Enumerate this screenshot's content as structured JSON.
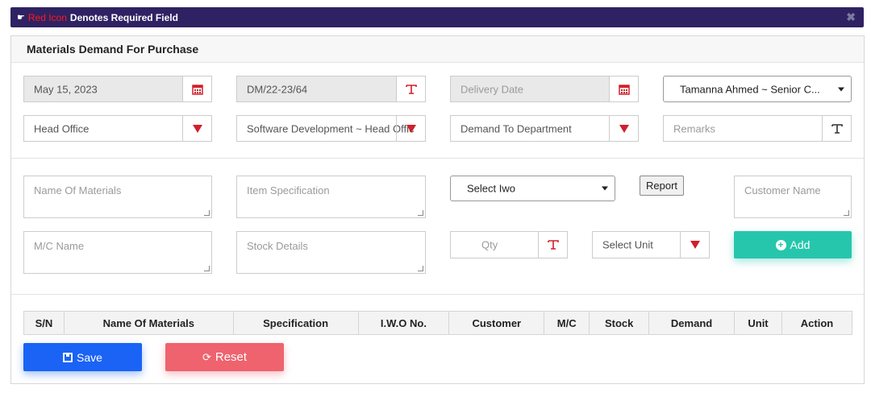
{
  "notice": {
    "hand_icon": "hand-point-right-icon",
    "red_text": "Red Icon",
    "white_text": "Denotes Required Field",
    "close_label": "✖"
  },
  "panel": {
    "title": "Materials Demand For Purchase"
  },
  "row1": {
    "date_value": "May 15, 2023",
    "demand_no_value": "DM/22-23/64",
    "delivery_placeholder": "Delivery Date",
    "employee_selected": "Tamanna Ahmed ~ Senior C..."
  },
  "row2": {
    "office_value": "Head Office",
    "department_value": "Software Development ~ Head Offic",
    "demand_to_value": "Demand To Department",
    "remarks_placeholder": "Remarks"
  },
  "items": {
    "name_placeholder": "Name Of Materials",
    "spec_placeholder": "Item Specification",
    "iwo_selected": "Select Iwo",
    "report_label": "Report",
    "customer_placeholder": "Customer Name",
    "mc_placeholder": "M/C Name",
    "stock_placeholder": "Stock Details",
    "qty_placeholder": "Qty",
    "unit_value": "Select Unit",
    "add_label": "Add"
  },
  "table": {
    "columns": [
      "S/N",
      "Name Of Materials",
      "Specification",
      "I.W.O No.",
      "Customer",
      "M/C",
      "Stock",
      "Demand",
      "Unit",
      "Action"
    ]
  },
  "actions": {
    "save_label": "Save",
    "reset_label": "Reset"
  },
  "colors": {
    "header_bar": "#2f2263",
    "required_red": "#d0202a",
    "add_teal": "#26c6ad",
    "save_blue": "#1a63f5",
    "reset_red": "#ee636e"
  }
}
